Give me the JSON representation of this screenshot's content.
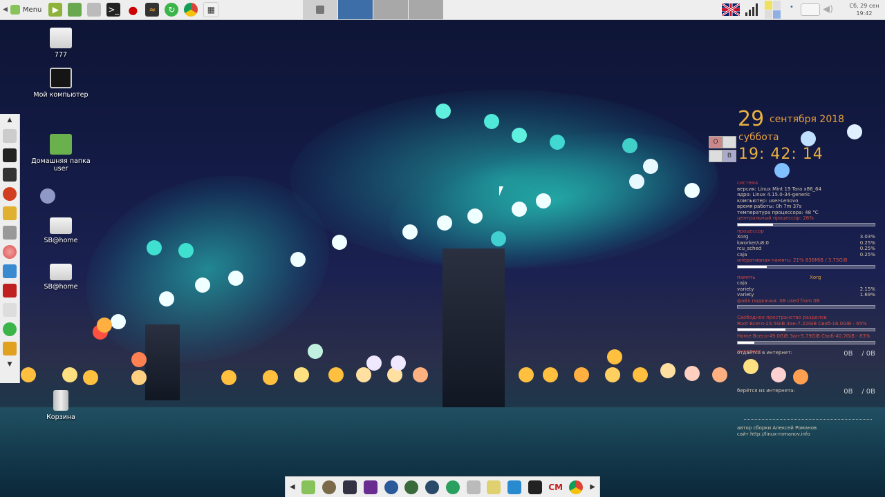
{
  "taskbar": {
    "menu_label": "Menu",
    "window_buttons": [
      {
        "name": "window-1"
      },
      {
        "name": "window-2-active"
      },
      {
        "name": "window-3"
      },
      {
        "name": "window-4"
      }
    ],
    "clock_line1": "Сб, 29 сен",
    "clock_line2": "19:42"
  },
  "desktop": {
    "icons": [
      {
        "label": "777",
        "icon": "usb-drive-icon"
      },
      {
        "label": "Мой компьютер",
        "icon": "monitor-icon"
      },
      {
        "label": "Домашняя папка user",
        "icon": "home-folder-icon"
      },
      {
        "label": "SB@home",
        "icon": "drive-icon"
      },
      {
        "label": "SB@home",
        "icon": "drive-icon"
      },
      {
        "label": "Корзина",
        "icon": "trash-icon"
      }
    ]
  },
  "dock": {
    "cm_label": "CM"
  },
  "conky": {
    "day": "29",
    "month_year": "сентября 2018",
    "weekday": "суббота",
    "time": "19: 42: 14",
    "kb_grid": [
      "O",
      "",
      "",
      "B"
    ],
    "system_header": "система",
    "system_lines": [
      "версия: Linux Mint 19 Tara x86_64",
      "ядро: Linux 4.15.0-34-generic",
      "компьютер: user-Lenovo",
      "время работы: 0h 7m 37s",
      "температура процессора: 48 °C",
      "центральный процессор: 26%"
    ],
    "cpu_bar": 0.26,
    "cpu_header": "процессор",
    "cpu_header_val": "",
    "cpu_procs": [
      {
        "name": "Xorg",
        "val": "3.03%"
      },
      {
        "name": "kworker/u8:0",
        "val": "0.25%"
      },
      {
        "name": "rcu_sched",
        "val": "0.25%"
      },
      {
        "name": "caja",
        "val": "0.25%"
      }
    ],
    "ram_line": "оперативная память: 21% 836MiB / 3.75GiB",
    "ram_bar": 0.21,
    "mem_header": "память",
    "mem_header_mid": "Xorg",
    "mem_procs": [
      {
        "name": "caja",
        "val": ""
      },
      {
        "name": "variety",
        "val": "2.15%"
      },
      {
        "name": "variety",
        "val": "1.69%"
      }
    ],
    "swap_line": "файл подкачки: 0B   used from 0B",
    "swap_bar": 0.0,
    "disk_header": "Свободное пространство разделов",
    "root_line": "Root Всего-24.5GiB Зан-7.22GiB Своб-16.0GiB - 65%",
    "root_bar": 0.35,
    "home_line": "Home Всего-49.0GiB Зан-5.79GiB Своб-40.7GiB - 83%",
    "home_bar": 0.12,
    "net_header": "интернет",
    "net_up_label": "отдаётся в интернет:",
    "net_up_val": "0B",
    "net_up_val2": "/ 0B",
    "net_down_label": "берётся из интернета:",
    "net_down_val": "0B",
    "net_down_val2": "/ 0B",
    "author_line": "автор сборки Алексей Романов",
    "site_line": "сайт http://linux-romanov.info"
  },
  "colors": {
    "panel_bg": "#eeeeee",
    "conky_accent": "#e8b040",
    "conky_head": "#d04040"
  }
}
